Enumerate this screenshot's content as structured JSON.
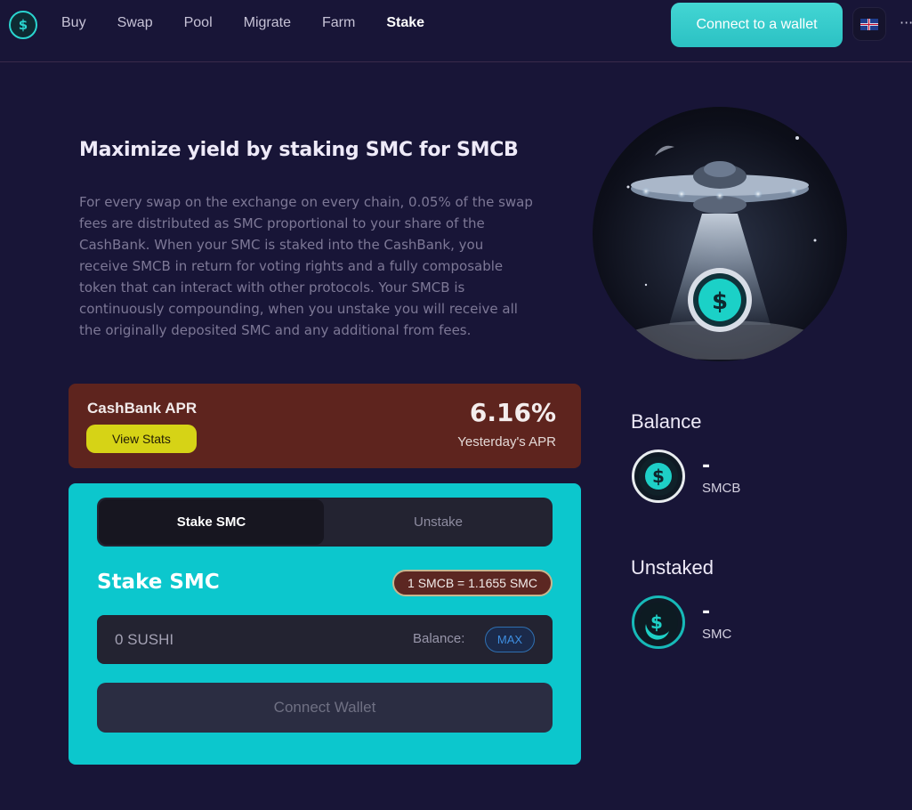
{
  "nav": {
    "logo_icon": "safemoon-cash-logo-icon",
    "items": [
      "Buy",
      "Swap",
      "Pool",
      "Migrate",
      "Farm",
      "Stake"
    ],
    "active": "Stake",
    "connect_label": "Connect to a wallet",
    "more_label": "···"
  },
  "intro": {
    "title": "Maximize yield by staking SMC for SMCB",
    "text": "For every swap on the exchange on every chain, 0.05% of the swap fees are distributed as SMC proportional to your share of the CashBank. When your SMC is staked into the CashBank, you receive SMCB in return for voting rights and a fully composable token that can interact with other protocols. Your SMCB is continuously compounding, when you unstake you will receive all the originally deposited SMC and any additional from fees."
  },
  "apr": {
    "label": "CashBank APR",
    "stats_button": "View Stats",
    "value": "6.16%",
    "sub": "Yesterday's APR"
  },
  "stake": {
    "tabs": [
      "Stake SMC",
      "Unstake"
    ],
    "heading": "Stake SMC",
    "rate": "1 SMCB = 1.1655 SMC",
    "input_placeholder": "0 SUSHI",
    "balance_label": "Balance:",
    "max_label": "MAX",
    "wallet_button": "Connect Wallet"
  },
  "balance": {
    "title": "Balance",
    "value": "-",
    "token": "SMCB"
  },
  "unstaked": {
    "title": "Unstaked",
    "value": "-",
    "token": "SMC"
  },
  "colors": {
    "background": "#181537",
    "accent": "#2bc1c3",
    "card_teal": "#0cc7cd",
    "apr_card": "#5e241e",
    "stats_button": "#d6d316"
  }
}
